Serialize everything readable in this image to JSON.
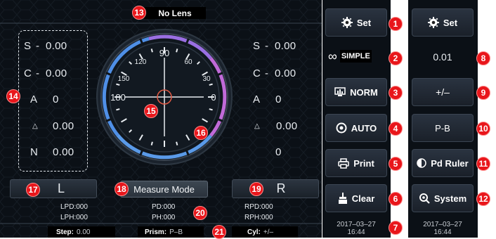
{
  "status": {
    "lens_state": "No Lens"
  },
  "left_lens": {
    "rows": [
      {
        "label": "S",
        "sep": "-",
        "value": "0.00"
      },
      {
        "label": "C",
        "sep": "-",
        "value": "0.00"
      },
      {
        "label": "A",
        "sep": "",
        "value": "0"
      },
      {
        "label": "△",
        "sep": "",
        "value": "0.00"
      },
      {
        "label": "N",
        "sep": "",
        "value": "0.00"
      }
    ]
  },
  "right_lens": {
    "rows": [
      {
        "label": "S",
        "sep": "-",
        "value": "0.00"
      },
      {
        "label": "C",
        "sep": "-",
        "value": "0.00"
      },
      {
        "label": "A",
        "sep": "",
        "value": "0"
      },
      {
        "label": "△",
        "sep": "",
        "value": "0.00"
      },
      {
        "label": "",
        "sep": "",
        "value": "0"
      }
    ]
  },
  "dial": {
    "angles": [
      "90",
      "120",
      "60",
      "150",
      "30",
      "180",
      "0"
    ]
  },
  "bottom_buttons": {
    "left": "L",
    "measure_mode": "Measure Mode",
    "right": "R"
  },
  "pd_info": {
    "lpd": "LPD:000",
    "pd": "PD:000",
    "rpd": "RPD:000",
    "lph": "LPH:000",
    "ph": "PH:000",
    "rph": "RPH:000"
  },
  "footer": {
    "step_label": "Step:",
    "step_value": "0.00",
    "prism_label": "Prism:",
    "prism_value": "P–B",
    "cyl_label": "Cyl:",
    "cyl_value": "+/–"
  },
  "panel1": {
    "set": "Set",
    "mode_icon": "∞",
    "mode": "SIMPLE",
    "norm": "NORM",
    "auto": "AUTO",
    "print": "Print",
    "clear": "Clear",
    "date": "2017–03–27",
    "time": "16:44"
  },
  "panel2": {
    "set": "Set",
    "step": "0.01",
    "cyl": "+/–",
    "prism": "P-B",
    "pd_ruler": "Pd Ruler",
    "system": "System",
    "date": "2017–03–27",
    "time": "16:44"
  },
  "callouts": [
    "1",
    "2",
    "3",
    "4",
    "5",
    "6",
    "7",
    "8",
    "9",
    "10",
    "11",
    "12",
    "13",
    "14",
    "15",
    "16",
    "17",
    "18",
    "19",
    "20",
    "21"
  ],
  "colors": {
    "badge": "#e8161b",
    "dial_blue": "#4f8fe6",
    "dial_purple": "#b15fd8",
    "crosshair_ring": "#e05a45"
  }
}
